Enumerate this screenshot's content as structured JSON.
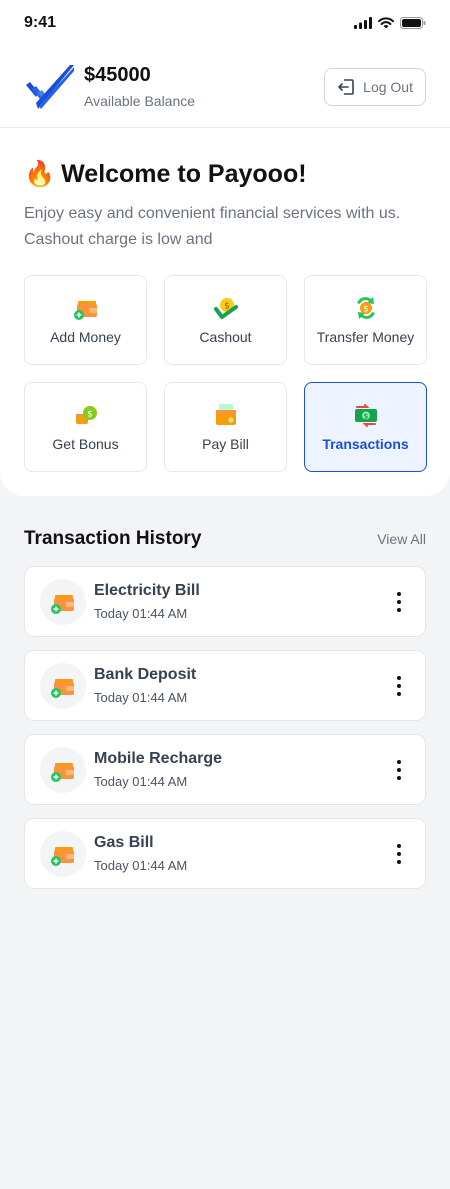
{
  "status_bar": {
    "time": "9:41"
  },
  "header": {
    "balance": "$45000",
    "balance_label": "Available Balance",
    "logout_label": "Log Out"
  },
  "welcome": {
    "emoji": "🔥",
    "title": "Welcome to Payooo!",
    "description": "Enjoy easy and convenient financial services with us. Cashout charge is low and"
  },
  "actions": [
    {
      "label": "Add Money",
      "icon": "wallet-add-icon"
    },
    {
      "label": "Cashout",
      "icon": "cashout-icon"
    },
    {
      "label": "Transfer Money",
      "icon": "transfer-icon"
    },
    {
      "label": "Get Bonus",
      "icon": "bonus-icon"
    },
    {
      "label": "Pay Bill",
      "icon": "bill-icon"
    },
    {
      "label": "Transactions",
      "icon": "transactions-icon",
      "active": true
    }
  ],
  "history": {
    "title": "Transaction History",
    "view_all": "View All",
    "items": [
      {
        "name": "Electricity Bill",
        "time": "Today 01:44 AM"
      },
      {
        "name": "Bank Deposit",
        "time": "Today 01:44 AM"
      },
      {
        "name": "Mobile Recharge",
        "time": "Today 01:44 AM"
      },
      {
        "name": "Gas Bill",
        "time": "Today 01:44 AM"
      }
    ]
  },
  "colors": {
    "accent": "#1d4ed8",
    "background": "#f3f4f6",
    "card": "#ffffff"
  }
}
